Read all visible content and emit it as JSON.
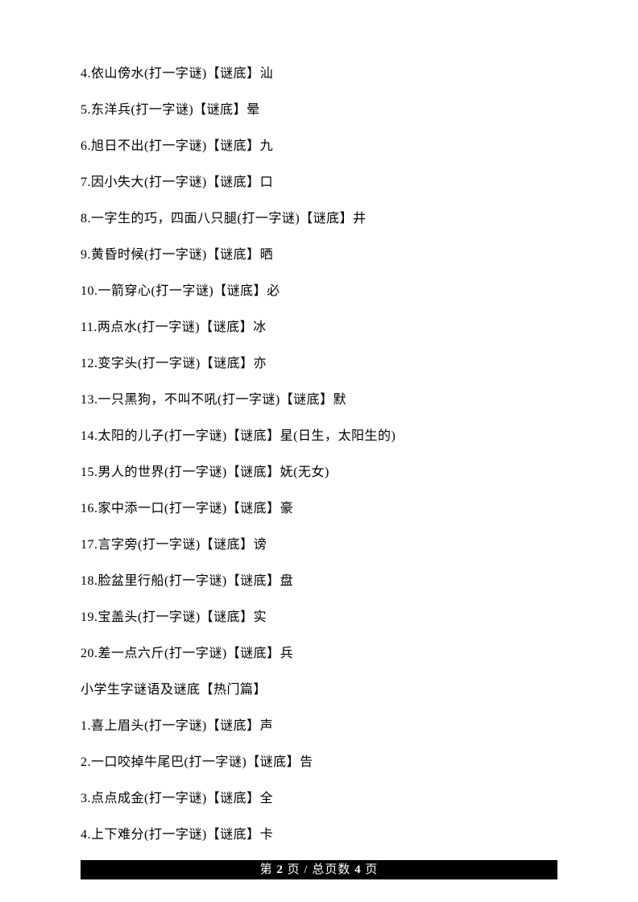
{
  "lines": [
    "4.依山傍水(打一字谜)【谜底】汕",
    "5.东洋兵(打一字谜)【谜底】晕",
    "6.旭日不出(打一字谜)【谜底】九",
    "7.因小失大(打一字谜)【谜底】口",
    "8.一字生的巧，四面八只腿(打一字谜)【谜底】井",
    "9.黄昏时候(打一字谜)【谜底】晒",
    "10.一箭穿心(打一字谜)【谜底】必",
    "11.两点水(打一字谜)【谜底】冰",
    "12.变字头(打一字谜)【谜底】亦",
    "13.一只黑狗，不叫不吼(打一字谜)【谜底】默",
    "14.太阳的儿子(打一字谜)【谜底】星(日生，太阳生的)",
    "15.男人的世界(打一字谜)【谜底】妩(无女)",
    "16.家中添一口(打一字谜)【谜底】豪",
    "17.言字旁(打一字谜)【谜底】谤",
    "18.脸盆里行船(打一字谜)【谜底】盘",
    "19.宝盖头(打一字谜)【谜底】实",
    "20.差一点六斤(打一字谜)【谜底】兵",
    "小学生字谜语及谜底【热门篇】",
    "1.喜上眉头(打一字谜)【谜底】声",
    "2.一口咬掉牛尾巴(打一字谜)【谜底】告",
    "3.点点成金(打一字谜)【谜底】全",
    "4.上下难分(打一字谜)【谜底】卡"
  ],
  "footer": {
    "prefix": "第 ",
    "current": "2",
    "mid1": " 页 / 总页数  ",
    "total": "4",
    "suffix": " 页"
  }
}
